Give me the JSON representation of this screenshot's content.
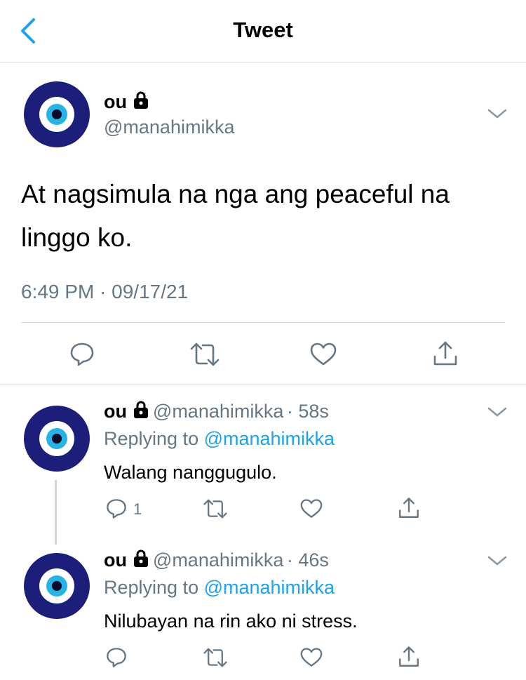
{
  "header": {
    "title": "Tweet"
  },
  "main_tweet": {
    "name": "ou",
    "handle": "@manahimikka",
    "text": "At nagsimula na nga ang peaceful na linggo ko.",
    "timestamp": "6:49 PM · 09/17/21"
  },
  "replies": [
    {
      "name": "ou",
      "handle": "@manahimikka",
      "age": "· 58s",
      "replying_prefix": "Replying to ",
      "replying_to": "@manahimikka",
      "text": "Walang nanggugulo.",
      "reply_count": "1"
    },
    {
      "name": "ou",
      "handle": "@manahimikka",
      "age": "· 46s",
      "replying_prefix": "Replying to ",
      "replying_to": "@manahimikka",
      "text": "Nilubayan na rin ako ni stress.",
      "reply_count": ""
    }
  ],
  "colors": {
    "accent": "#1da1f2",
    "secondary_text": "#657786",
    "avatar_eye_outer": "#1b1f7a",
    "avatar_eye_iris": "#26b3e6"
  },
  "icons": [
    "back-icon",
    "lock-icon",
    "chevron-down-icon",
    "reply-icon",
    "retweet-icon",
    "like-icon",
    "share-icon"
  ]
}
